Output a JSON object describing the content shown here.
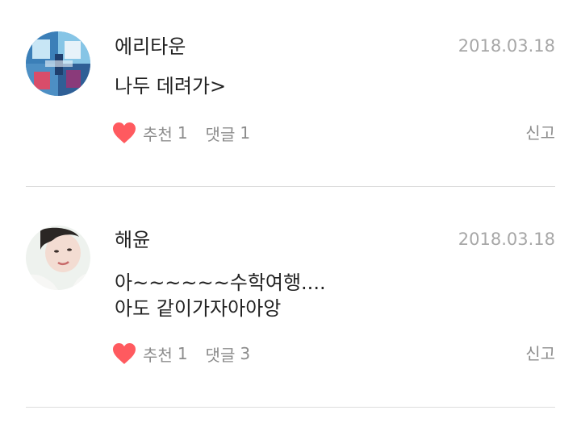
{
  "comments": [
    {
      "author": "에리타운",
      "date": "2018.03.18",
      "body_lines": [
        "나두 데려가>"
      ],
      "like_label": "추천",
      "like_count": "1",
      "reply_label": "댓글",
      "reply_count": "1",
      "report_label": "신고",
      "heart_color": "#ff5a5f"
    },
    {
      "author": "해윤",
      "date": "2018.03.18",
      "body_lines": [
        "아~~~~~~수학여행....",
        "아도 같이가자아아앙"
      ],
      "like_label": "추천",
      "like_count": "1",
      "reply_label": "댓글",
      "reply_count": "3",
      "report_label": "신고",
      "heart_color": "#ff5a5f"
    }
  ]
}
